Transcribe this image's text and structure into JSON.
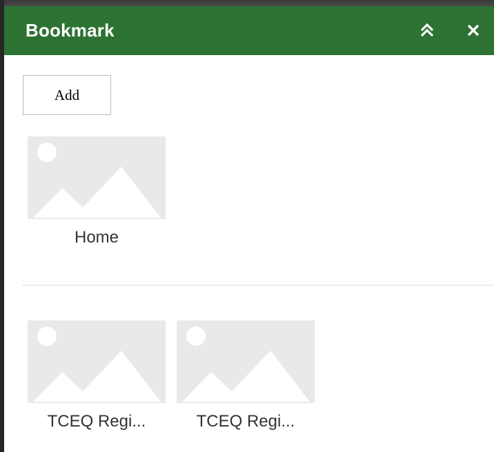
{
  "panel": {
    "title": "Bookmark",
    "header_color": "#2d7233",
    "collapse_icon": "double-chevron-up-icon",
    "close_icon": "close-icon"
  },
  "toolbar": {
    "add_label": "Add"
  },
  "bookmarks": {
    "default": [
      {
        "label": "Home",
        "thumbnail_icon": "image-placeholder-icon"
      }
    ],
    "custom": [
      {
        "label": "TCEQ Regi...",
        "thumbnail_icon": "image-placeholder-icon"
      },
      {
        "label": "TCEQ Regi...",
        "thumbnail_icon": "image-placeholder-icon"
      }
    ]
  }
}
